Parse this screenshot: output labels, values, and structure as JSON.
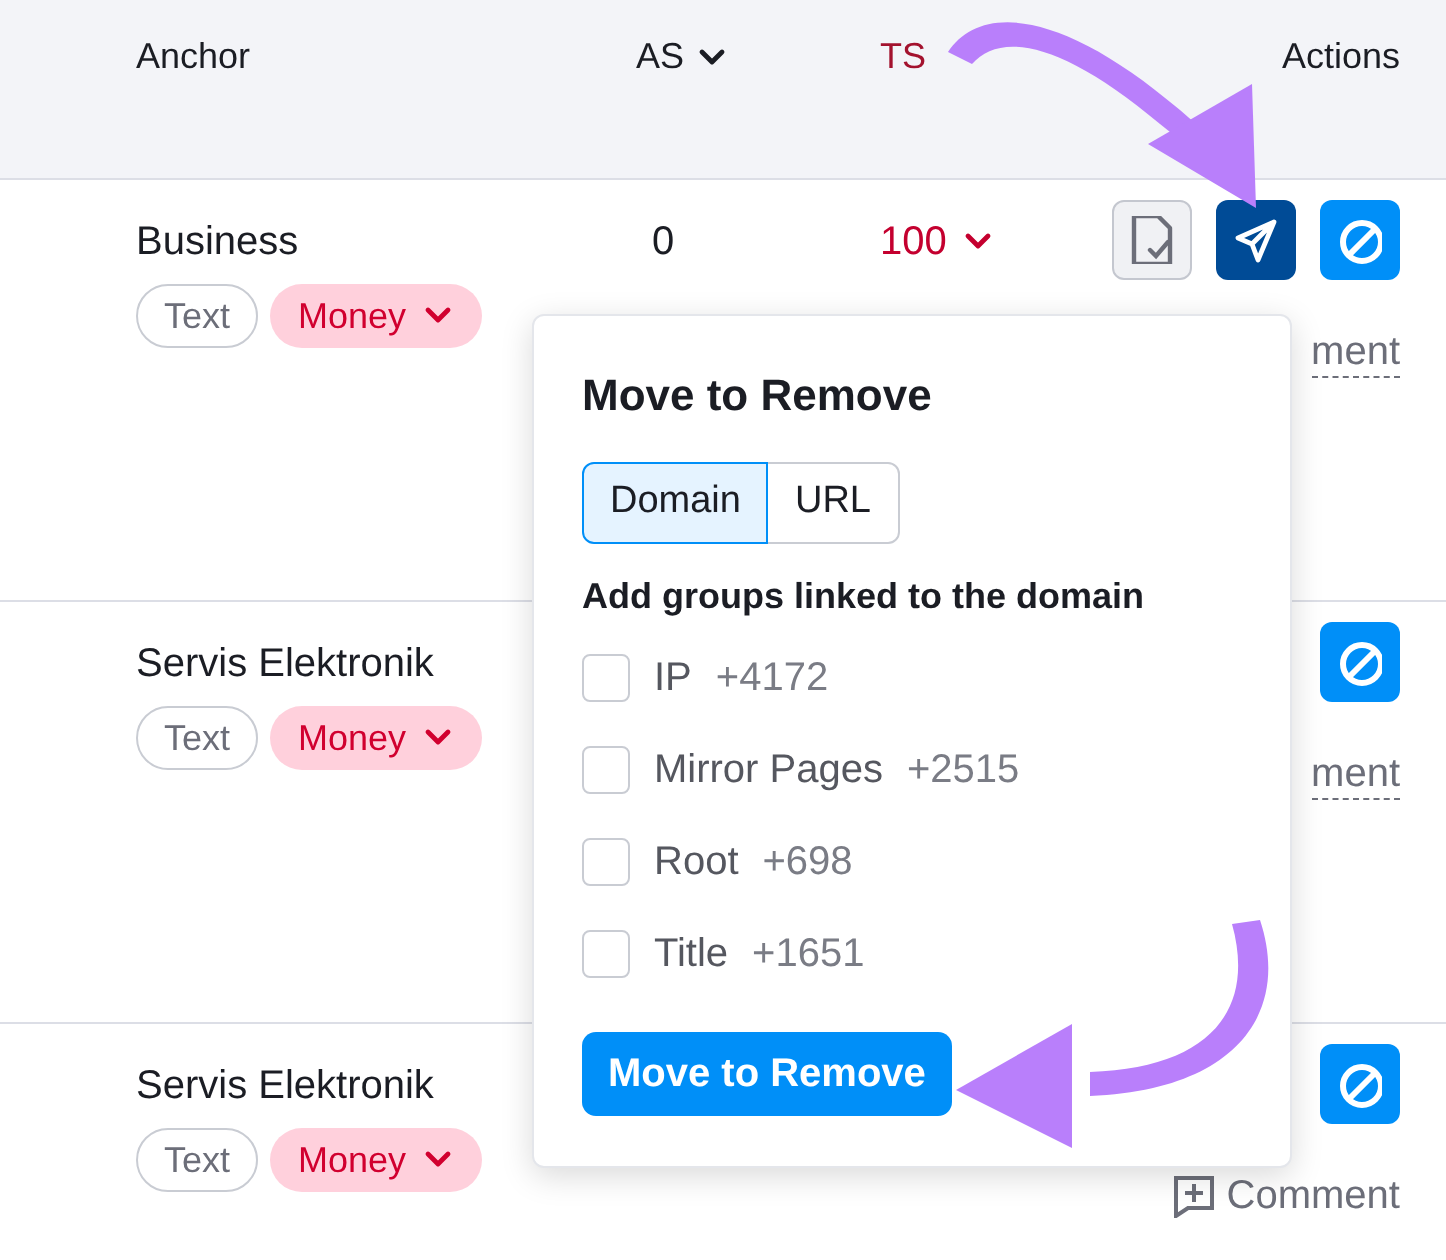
{
  "table": {
    "columns": [
      {
        "label": "Anchor",
        "sort_indicator": false,
        "highlighted": false
      },
      {
        "label": "AS",
        "sort_indicator": true,
        "highlighted": false
      },
      {
        "label": "TS",
        "sort_indicator": false,
        "highlighted": true
      },
      {
        "label": "Actions",
        "sort_indicator": false,
        "highlighted": false
      }
    ],
    "rows": [
      {
        "anchor": "Business",
        "tags": [
          {
            "label": "Text",
            "kind": "plain"
          },
          {
            "label": "Money",
            "kind": "money"
          }
        ],
        "as": "0",
        "ts": "100",
        "buttons": [
          {
            "kind": "review"
          },
          {
            "kind": "send"
          },
          {
            "kind": "block"
          }
        ],
        "comment": {
          "text": "ment",
          "icon": false
        }
      },
      {
        "anchor": "Servis Elektronik",
        "tags": [
          {
            "label": "Text",
            "kind": "plain"
          },
          {
            "label": "Money",
            "kind": "money"
          }
        ],
        "buttons": [
          {
            "kind": "block"
          }
        ],
        "comment": {
          "text": "ment",
          "icon": false
        }
      },
      {
        "anchor": "Servis Elektronik",
        "tags": [
          {
            "label": "Text",
            "kind": "plain"
          },
          {
            "label": "Money",
            "kind": "money"
          }
        ],
        "buttons": [
          {
            "kind": "block"
          }
        ],
        "comment": {
          "text": "Comment",
          "icon": true
        }
      }
    ]
  },
  "popup": {
    "title": "Move to Remove",
    "scope_tabs": [
      {
        "label": "Domain",
        "selected": true
      },
      {
        "label": "URL",
        "selected": false
      }
    ],
    "subtitle": "Add groups linked to the domain",
    "groups": [
      {
        "name": "IP",
        "count": "+4172",
        "checked": false
      },
      {
        "name": "Mirror Pages",
        "count": "+2515",
        "checked": false
      },
      {
        "name": "Root",
        "count": "+698",
        "checked": false
      },
      {
        "name": "Title",
        "count": "+1651",
        "checked": false
      }
    ],
    "button": "Move to Remove"
  }
}
